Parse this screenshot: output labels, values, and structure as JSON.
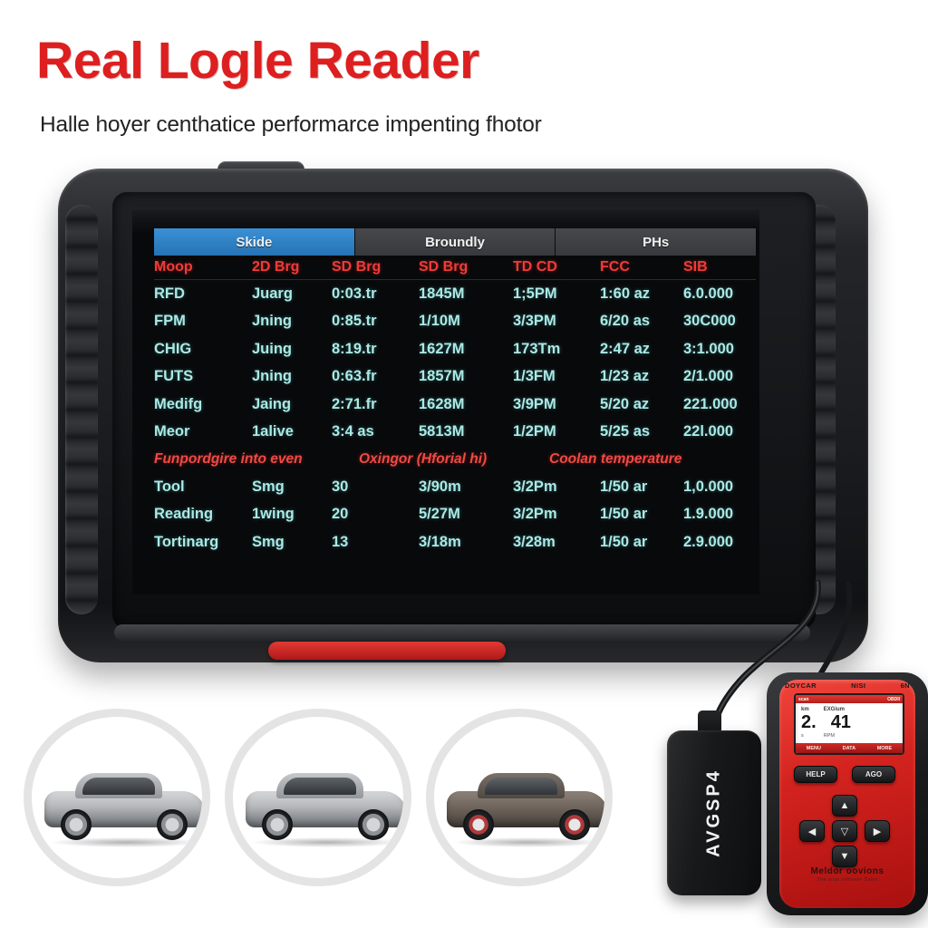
{
  "header": {
    "title": "Real Logle Reader",
    "subtitle": "Halle hoyer centhatice performarce impenting fhotor"
  },
  "colors": {
    "title_red": "#dd1f1f",
    "tab_active_blue": "#2E80C8",
    "screen_text_cyan": "#a9eae6",
    "screen_header_red": "#ef3c38",
    "device_red": "#d4231f",
    "bezel_black": "#1a1c1f"
  },
  "tablet": {
    "tabs": [
      {
        "label": "Skide",
        "active": true
      },
      {
        "label": "Broundly",
        "active": false
      },
      {
        "label": "PHs",
        "active": false
      }
    ],
    "columns": [
      "Moop",
      "2D Brg",
      "SD Brg",
      "SD Brg",
      "TD CD",
      "FCC",
      "SIB"
    ],
    "rows": [
      [
        "RFD",
        "Juarg",
        "0:03.tr",
        "1845M",
        "1;5PM",
        "1:60 az",
        "6.0.000"
      ],
      [
        "FPM",
        "Jning",
        "0:85.tr",
        "1/10M",
        "3/3PM",
        "6/20 as",
        "30C000"
      ],
      [
        "CHIG",
        "Juing",
        "8:19.tr",
        "1627M",
        "173Tm",
        "2:47 az",
        "3:1.000"
      ],
      [
        "FUTS",
        "Jning",
        "0:63.fr",
        "1857M",
        "1/3FM",
        "1/23 az",
        "2/1.000"
      ],
      [
        "Medifg",
        "Jaing",
        "2:71.fr",
        "1628M",
        "3/9PM",
        "5/20 az",
        "221.000"
      ],
      [
        "Meor",
        "1alive",
        "3:4 as",
        "5813M",
        "1/2PM",
        "5/25 as",
        "22l.000"
      ]
    ],
    "sections": [
      "Funpordgire into even",
      "Oxingor (Hforial hi)",
      "Coolan temperature"
    ],
    "rows2": [
      [
        "Tool",
        "Smg",
        "30",
        "3/90m",
        "3/2Pm",
        "1/50 ar",
        "1,0.000"
      ],
      [
        "Reading",
        "1wing",
        "20",
        "5/27M",
        "3/2Pm",
        "1/50 ar",
        "1.9.000"
      ],
      [
        "Tortinarg",
        "Smg",
        "13",
        "3/18m",
        "3/28m",
        "1/50 ar",
        "2.9.000"
      ]
    ]
  },
  "dongle": {
    "label": "AVGSP4"
  },
  "scanner": {
    "brand_top_left": "DOYCAR",
    "brand_top_mid": "NISI",
    "brand_top_right": "6N",
    "lcd": {
      "topbar_left": "scan",
      "topbar_right": "OBDII",
      "label_left": "km",
      "label_right": "EXGium",
      "value_left": "2.",
      "value_right": "41",
      "unit_left": "s",
      "unit_right": "RPM",
      "botbar": [
        "MENU",
        "DATA",
        "MORE"
      ]
    },
    "keys": {
      "help": "HELP",
      "back": "AGO",
      "up": "▲",
      "down": "▼",
      "left": "◀",
      "right": "▶",
      "ok": "▽"
    },
    "brand_bottom": "Meldor oovions",
    "brand_bottom_sub": "The scan software Sales"
  },
  "cars": [
    {
      "name": "car-thumbnail-1",
      "tone": "silver"
    },
    {
      "name": "car-thumbnail-2",
      "tone": "silver"
    },
    {
      "name": "car-thumbnail-3",
      "tone": "dark"
    }
  ]
}
